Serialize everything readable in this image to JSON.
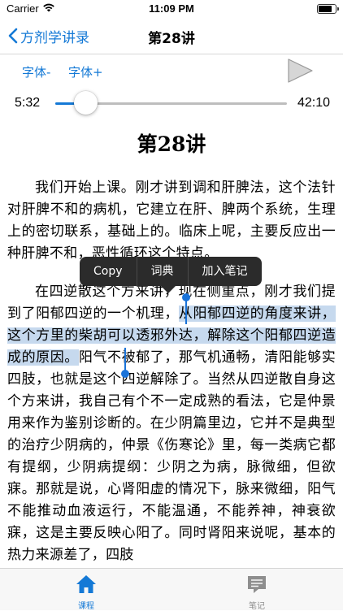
{
  "status_bar": {
    "carrier": "Carrier",
    "time": "11:09 PM",
    "battery_level": 0.9
  },
  "nav": {
    "back_label": "方剂学讲录",
    "title": "第28讲"
  },
  "controls": {
    "font_decrease": "字体-",
    "font_increase": "字体+"
  },
  "player": {
    "current_time": "5:32",
    "total_time": "42:10",
    "progress": 0.13
  },
  "article": {
    "title": "第28讲",
    "paragraph1": "我们开始上课。刚才讲到调和肝脾法，这个法针对肝脾不和的病机，它建立在肝、脾两个系统，生理上的密切联系，基础上的。临床上呢，主要反应出一种肝脾不和，恶性循环这个特点。",
    "paragraph2_before": "在四逆散这个方来讲，现在侧重点，刚才我们提到了阳郁四逆的一个机理，",
    "paragraph2_selected": "从阳郁四逆的角度来讲，这个方里的柴胡可以透邪外达，解除这个阳郁四逆造成的原因。",
    "paragraph2_after": "阳气不被郁了，那气机通畅，清阳能够实四肢，也就是这个四逆解除了。当然从四逆散自身这个方来讲，我自己有个不一定成熟的看法，它是仲景用来作为鉴别诊断的。在少阴篇里边，它并不是典型的治疗少阴病的，仲景《伤寒论》里，每一类病它都有提纲，少阴病提纲：少阴之为病，脉微细，但欲寐。那就是说，心肾阳虚的情况下，脉来微细，阳气不能推动血液运行，不能温通，不能养神，神衰欲寐，这是主要反映心阳了。同时肾阳来说呢，基本的热力来源差了，四肢"
  },
  "edit_menu": {
    "copy": "Copy",
    "dictionary": "词典",
    "add_note": "加入笔记"
  },
  "tabs": [
    {
      "label": "课程",
      "icon": "home-icon",
      "active": true
    },
    {
      "label": "笔记",
      "icon": "notes-icon",
      "active": false
    }
  ],
  "colors": {
    "accent": "#1479d6",
    "selection": "#c6d9ee",
    "tab_inactive": "#8e8e8e",
    "menu_bg": "#2b2b2b"
  }
}
